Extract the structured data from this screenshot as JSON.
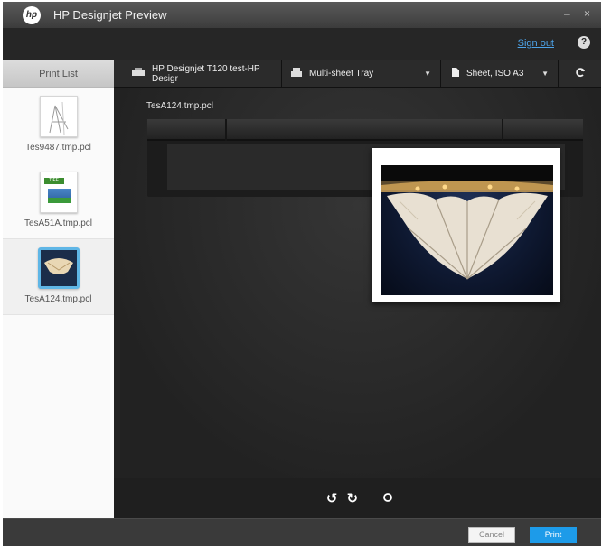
{
  "app": {
    "title": "HP Designjet Preview",
    "logo": "hp",
    "window_controls": "– ×"
  },
  "account": {
    "sign_out_label": "Sign out",
    "help_icon": "?"
  },
  "sidebar": {
    "header": "Print List",
    "items": [
      {
        "filename": "Tes9487.tmp.pcl",
        "thumb": "sketch-document",
        "selected": false
      },
      {
        "filename": "TesA51A.tmp.pcl",
        "thumb": "tiff-image",
        "badge": "TIFF",
        "selected": false
      },
      {
        "filename": "TesA124.tmp.pcl",
        "thumb": "photo",
        "selected": true
      }
    ]
  },
  "toolbar": {
    "printer": "HP Designjet T120 test-HP Desigr",
    "tray": "Multi-sheet Tray",
    "paper": "Sheet, ISO A3",
    "refresh_icon": "refresh"
  },
  "preview": {
    "document_name": "TesA124.tmp.pcl"
  },
  "footer": {
    "cancel_label": "Cancel",
    "print_label": "Print"
  },
  "colors": {
    "accent": "#1d9be9",
    "link": "#4da3e8",
    "selected_border": "#5fb6e6"
  }
}
